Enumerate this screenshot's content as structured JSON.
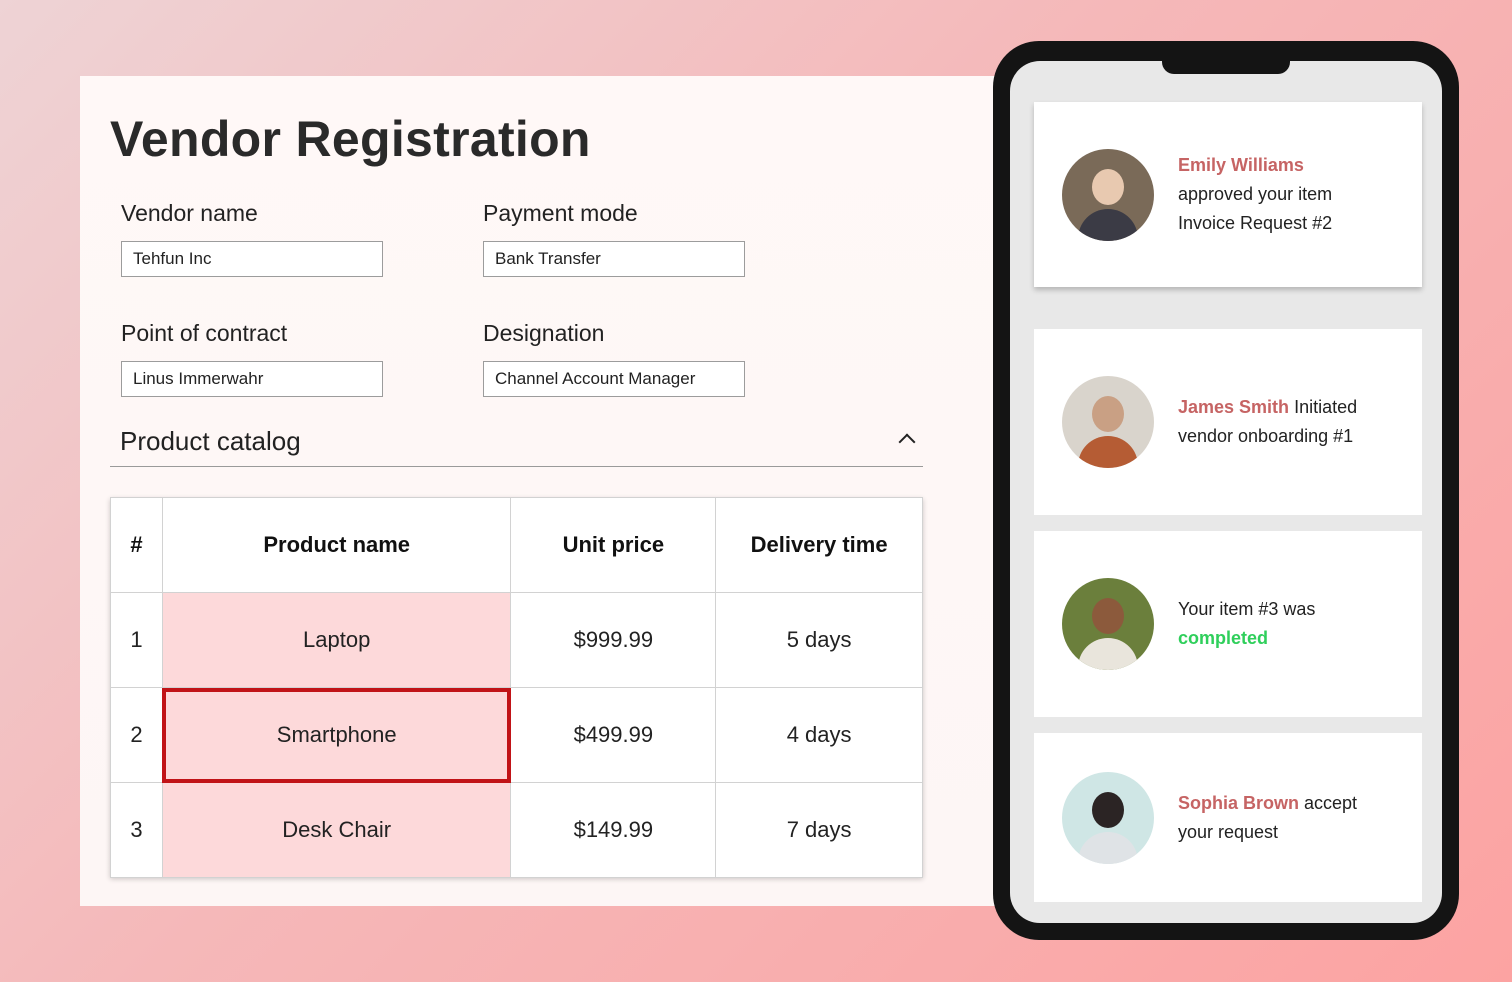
{
  "form": {
    "title": "Vendor Registration",
    "fields": {
      "vendor_name": {
        "label": "Vendor name",
        "value": "Tehfun Inc"
      },
      "payment_mode": {
        "label": "Payment mode",
        "value": "Bank Transfer"
      },
      "point_of_contact": {
        "label": "Point of contract",
        "value": "Linus Immerwahr"
      },
      "designation": {
        "label": "Designation",
        "value": "Channel Account Manager"
      }
    },
    "catalog": {
      "title": "Product catalog",
      "columns": [
        "#",
        "Product name",
        "Unit price",
        "Delivery time"
      ],
      "rows": [
        {
          "num": "1",
          "name": "Laptop",
          "price": "$999.99",
          "delivery": "5 days"
        },
        {
          "num": "2",
          "name": "Smartphone",
          "price": "$499.99",
          "delivery": "4 days"
        },
        {
          "num": "3",
          "name": "Desk Chair",
          "price": "$149.99",
          "delivery": "7 days"
        }
      ],
      "selected_row": 2,
      "highlight_color": "#fdd9da",
      "selection_color": "#c11317"
    }
  },
  "notifications": [
    {
      "name": "Emily Williams",
      "line1": "approved your item",
      "line2": "Invoice Request #2"
    },
    {
      "name": "James Smith",
      "after": " Initiated",
      "line2": "vendor onboarding #1"
    },
    {
      "before": "Your item #3 was",
      "status": "completed"
    },
    {
      "name": "Sophia Brown",
      "after": " accept",
      "line2": "your request"
    }
  ],
  "colors": {
    "name_accent": "#c66464",
    "completed_accent": "#2fcf5b"
  }
}
